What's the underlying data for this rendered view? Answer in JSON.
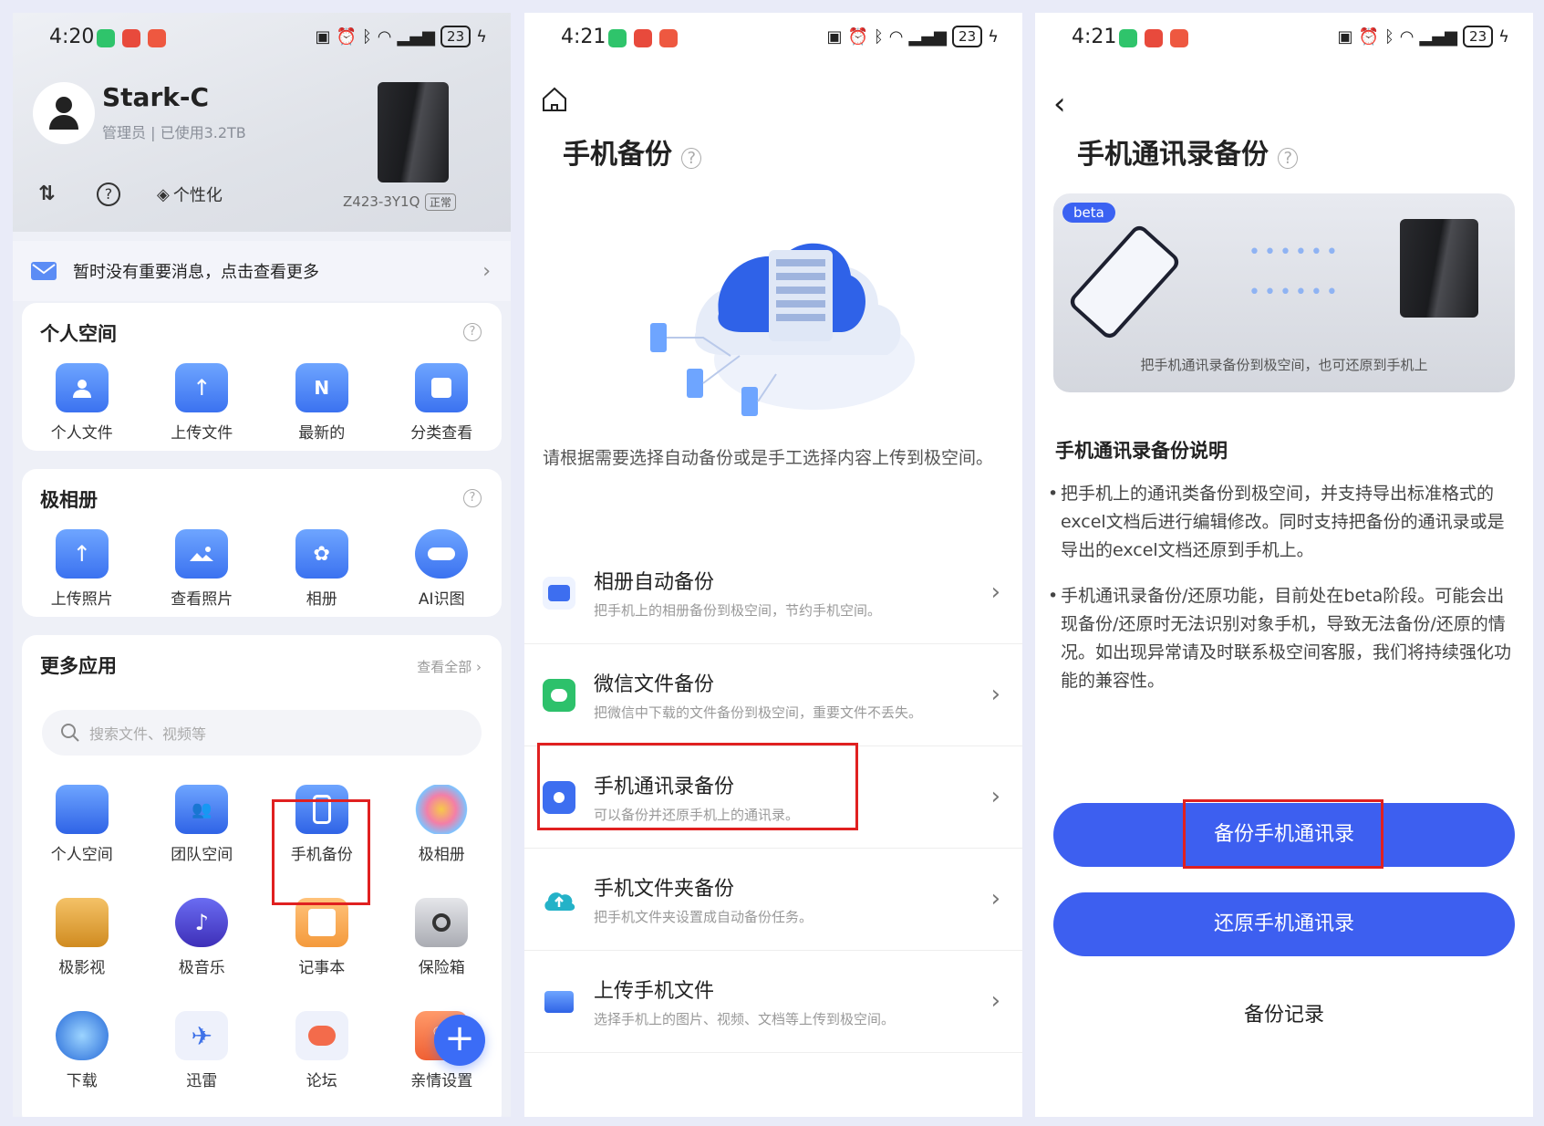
{
  "colors": {
    "accent": "#3b62f2",
    "highlight": "#e02020",
    "bg": "#e9ebf8"
  },
  "s1": {
    "time": "4:20",
    "battery": "23",
    "user": {
      "name": "Stark-C",
      "sub": "管理员 | 已使用3.2TB"
    },
    "device": {
      "name": "Z423-3Y1Q",
      "tag": "正常"
    },
    "toolbar": {
      "personalize": "个性化"
    },
    "message": "暂时没有重要消息，点击查看更多",
    "personal": {
      "title": "个人空间",
      "items": [
        {
          "label": "个人文件",
          "icon": "user-folder-icon"
        },
        {
          "label": "上传文件",
          "icon": "upload-folder-icon"
        },
        {
          "label": "最新的",
          "icon": "recent-icon"
        },
        {
          "label": "分类查看",
          "icon": "category-icon"
        }
      ]
    },
    "album": {
      "title": "极相册",
      "items": [
        {
          "label": "上传照片",
          "icon": "upload-photo-icon"
        },
        {
          "label": "查看照片",
          "icon": "view-photo-icon"
        },
        {
          "label": "相册",
          "icon": "album-icon"
        },
        {
          "label": "AI识图",
          "icon": "robot-icon"
        }
      ]
    },
    "more": {
      "title": "更多应用",
      "see_all": "查看全部 ›",
      "search_placeholder": "搜索文件、视频等",
      "items": [
        {
          "label": "个人空间",
          "icon": "folder-icon"
        },
        {
          "label": "团队空间",
          "icon": "team-folder-icon"
        },
        {
          "label": "手机备份",
          "icon": "phone-backup-icon"
        },
        {
          "label": "极相册",
          "icon": "photos-flower-icon"
        },
        {
          "label": "极影视",
          "icon": "video-icon"
        },
        {
          "label": "极音乐",
          "icon": "music-icon"
        },
        {
          "label": "记事本",
          "icon": "notepad-icon"
        },
        {
          "label": "保险箱",
          "icon": "safe-icon"
        },
        {
          "label": "下载",
          "icon": "download-icon"
        },
        {
          "label": "迅雷",
          "icon": "thunder-icon"
        },
        {
          "label": "论坛",
          "icon": "forum-icon"
        },
        {
          "label": "亲情设置",
          "icon": "family-icon"
        }
      ]
    }
  },
  "s2": {
    "time": "4:21",
    "battery": "23",
    "title": "手机备份",
    "intro": "请根据需要选择自动备份或是手工选择内容上传到极空间。",
    "rows": [
      {
        "title": "相册自动备份",
        "sub": "把手机上的相册备份到极空间，节约手机空间。",
        "icon": "album-backup-icon"
      },
      {
        "title": "微信文件备份",
        "sub": "把微信中下载的文件备份到极空间，重要文件不丢失。",
        "icon": "wechat-icon"
      },
      {
        "title": "手机通讯录备份",
        "sub": "可以备份并还原手机上的通讯录。",
        "icon": "contacts-icon"
      },
      {
        "title": "手机文件夹备份",
        "sub": "把手机文件夹设置成自动备份任务。",
        "icon": "cloud-upload-icon"
      },
      {
        "title": "上传手机文件",
        "sub": "选择手机上的图片、视频、文档等上传到极空间。",
        "icon": "folder-upload-icon"
      }
    ]
  },
  "s3": {
    "time": "4:21",
    "battery": "23",
    "title": "手机通讯录备份",
    "beta": "beta",
    "banner_caption": "把手机通讯录备份到极空间，也可还原到手机上",
    "section": "手机通讯录备份说明",
    "para1": "把手机上的通讯类备份到极空间，并支持导出标准格式的excel文档后进行编辑修改。同时支持把备份的通讯录或是导出的excel文档还原到手机上。",
    "para2": "手机通讯录备份/还原功能，目前处在beta阶段。可能会出现备份/还原时无法识别对象手机，导致无法备份/还原的情况。如出现异常请及时联系极空间客服，我们将持续强化功能的兼容性。",
    "backup_btn": "备份手机通讯录",
    "restore_btn": "还原手机通讯录",
    "history": "备份记录"
  }
}
